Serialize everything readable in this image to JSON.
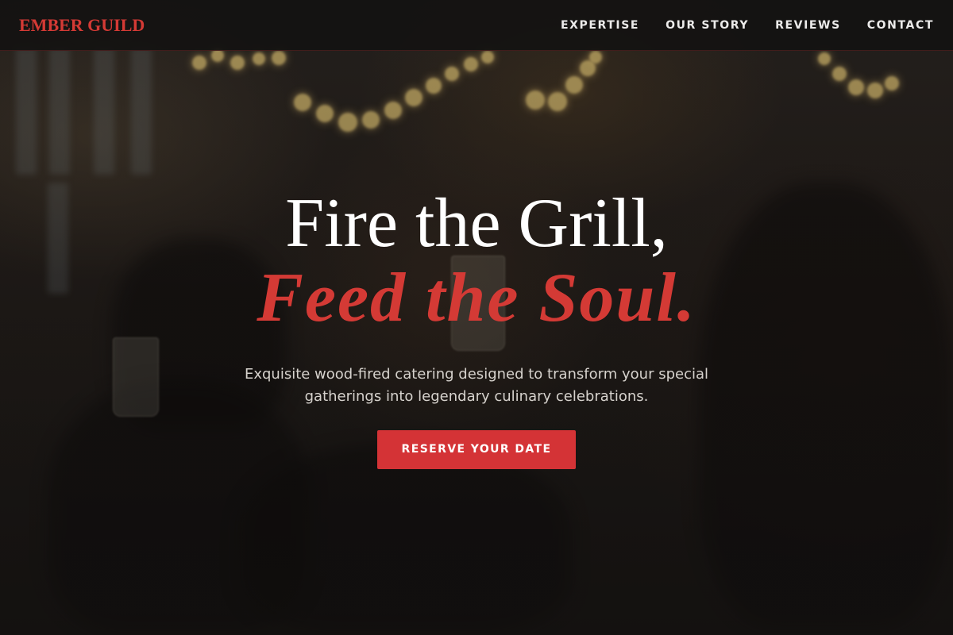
{
  "header": {
    "logo": "EMBER GUILD",
    "nav": [
      {
        "label": "EXPERTISE"
      },
      {
        "label": "OUR STORY"
      },
      {
        "label": "REVIEWS"
      },
      {
        "label": "CONTACT"
      }
    ]
  },
  "hero": {
    "headline_line1": "Fire the Grill,",
    "headline_line2": "Feed the Soul.",
    "subtitle": "Exquisite wood-fired catering designed to transform your special gatherings into legendary culinary celebrations.",
    "cta_label": "RESERVE YOUR DATE"
  },
  "colors": {
    "accent": "#d43a35",
    "header_bg": "#141211",
    "text_light": "#ecebea"
  }
}
